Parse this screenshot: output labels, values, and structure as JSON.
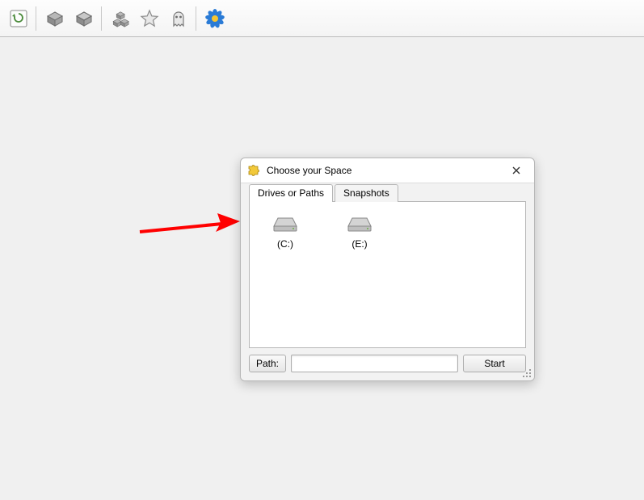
{
  "dialog": {
    "title": "Choose your Space",
    "tabs": {
      "drives": "Drives or Paths",
      "snapshots": "Snapshots"
    },
    "drives": [
      {
        "label": "(C:)"
      },
      {
        "label": "(E:)"
      }
    ],
    "path_button": "Path:",
    "path_value": "",
    "start_button": "Start"
  }
}
